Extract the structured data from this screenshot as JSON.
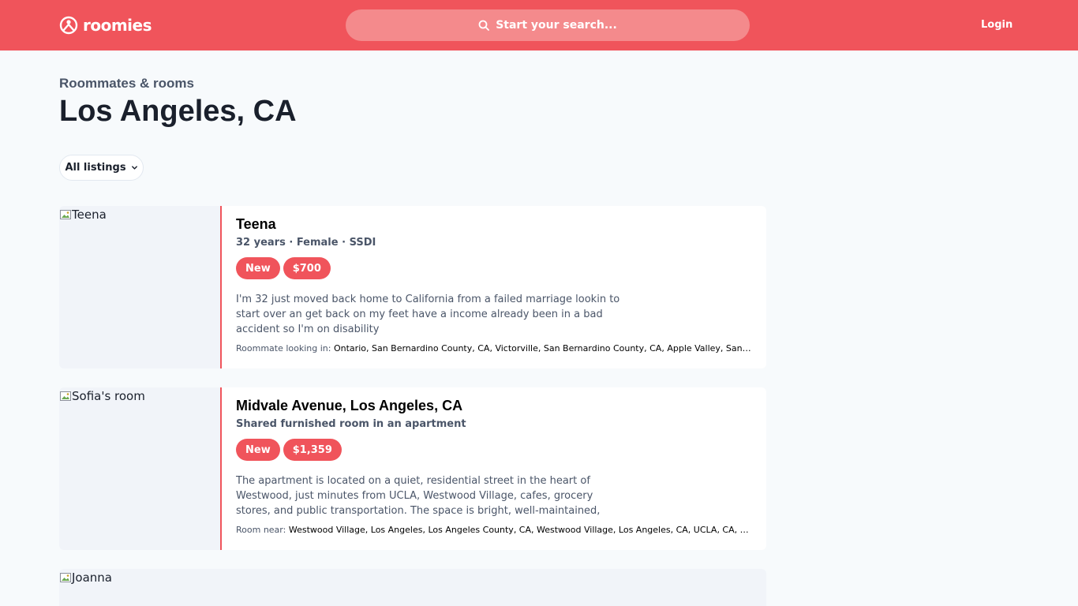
{
  "header": {
    "brand": "roomies",
    "search_placeholder": "Start your search...",
    "login_label": "Login",
    "accent_color": "#f0545b"
  },
  "page": {
    "subtitle": "Roommates & rooms",
    "title": "Los Angeles, CA",
    "filter_label": "All listings"
  },
  "listings": [
    {
      "image_alt": "Teena",
      "title": "Teena",
      "meta": "32 years · Female · SSDI",
      "badges": [
        "New",
        "$700"
      ],
      "description": "I'm 32 just moved back home to California from a failed marriage lookin to start over an get back on my feet have a income already been in a bad accident so I'm on disability",
      "location_label": "Roommate looking in:",
      "location": "Ontario, San Bernardino County, CA, Victorville, San Bernardino County, CA, Apple Valley, San Berna..."
    },
    {
      "image_alt": "Sofia's room",
      "title": "Midvale Avenue, Los Angeles, CA",
      "meta": "Shared furnished room in an apartment",
      "badges": [
        "New",
        "$1,359"
      ],
      "description": "The apartment is located on a quiet, residential street in the heart of Westwood, just minutes from UCLA, Westwood Village, cafes, grocery stores, and public transportation. The space is bright, well-maintained, and...",
      "location_label": "Room near:",
      "location": "Westwood Village, Los Angeles, Los Angeles County, CA, Westwood Village, Los Angeles, CA, UCLA, CA, Villag..."
    },
    {
      "image_alt": "Joanna"
    }
  ]
}
